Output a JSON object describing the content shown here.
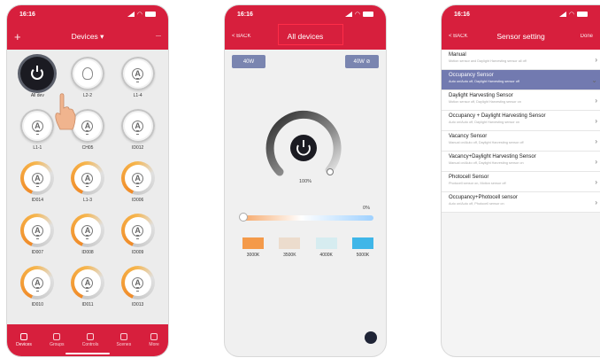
{
  "status": {
    "time": "16:16"
  },
  "screen1": {
    "nav": {
      "left": "+",
      "title": "Devices ▾",
      "right": "—"
    },
    "devices": [
      {
        "label": "All dev",
        "style": "dark"
      },
      {
        "label": "L2-2",
        "style": "grey-plain"
      },
      {
        "label": "L1-4",
        "style": "grey"
      },
      {
        "label": "L1-1",
        "style": "grey"
      },
      {
        "label": "CH05",
        "style": "grey"
      },
      {
        "label": "ID012",
        "style": "grey"
      },
      {
        "label": "ID014",
        "style": "orange"
      },
      {
        "label": "L1-3",
        "style": "orange"
      },
      {
        "label": "ID006",
        "style": "orange"
      },
      {
        "label": "ID007",
        "style": "orange"
      },
      {
        "label": "ID008",
        "style": "orange"
      },
      {
        "label": "ID009",
        "style": "orange"
      },
      {
        "label": "ID010",
        "style": "orange"
      },
      {
        "label": "ID011",
        "style": "orange"
      },
      {
        "label": "ID013",
        "style": "orange"
      }
    ],
    "tabs": [
      "Devices",
      "Groups",
      "Controls",
      "Scenes",
      "More"
    ]
  },
  "screen2": {
    "nav": {
      "back": "< BACK",
      "title": "All devices"
    },
    "left_button": "40W",
    "right_button": "40W ⊘",
    "brightness": "100%",
    "cct_pct": "0%",
    "swatches": [
      {
        "label": "3000K",
        "color": "#f49a4a"
      },
      {
        "label": "3500K",
        "color": "#ecdccd"
      },
      {
        "label": "4000K",
        "color": "#d6ecf0"
      },
      {
        "label": "5000K",
        "color": "#3fb6e8"
      }
    ]
  },
  "screen3": {
    "nav": {
      "back": "< BACK",
      "title": "Sensor setting",
      "right": "Done"
    },
    "items": [
      {
        "title": "Manual",
        "sub": "Motion sensor and Daylight Harvesting sensor all off"
      },
      {
        "title": "Occupancy Sensor",
        "sub": "Auto on/Auto off, Daylight Harvesting sensor off",
        "selected": true
      },
      {
        "title": "Daylight Harvesting Sensor",
        "sub": "Motion sensor off, Daylight Harvesting sensor on"
      },
      {
        "title": "Occupancy + Daylight Harvesting Sensor",
        "sub": "Auto on/Auto off, Daylight Harvesting sensor on"
      },
      {
        "title": "Vacancy Sensor",
        "sub": "Manual on/Auto off, Daylight Harvesting sensor off"
      },
      {
        "title": "Vacancy+Daylight Harvesting Sensor",
        "sub": "Manual on/Auto off, Daylight Harvesting sensor on"
      },
      {
        "title": "Photocell Sensor",
        "sub": "Photocell sensor on, Motion sensor off"
      },
      {
        "title": "Occupancy+Photocell sensor",
        "sub": "Auto on/Auto off, Photocell sensor on"
      }
    ]
  },
  "colors": {
    "brand": "#d71f3d",
    "selected": "#727ab0",
    "button": "#7a85b0"
  }
}
